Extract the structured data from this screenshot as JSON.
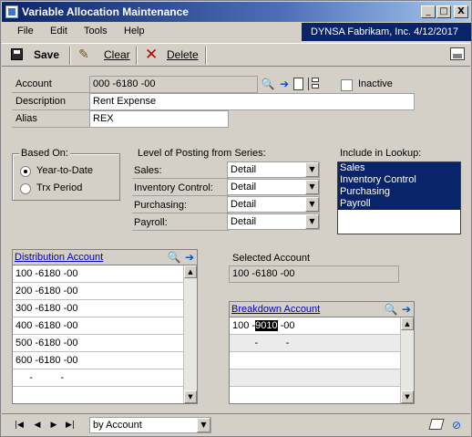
{
  "window": {
    "title": "Variable Allocation Maintenance",
    "minimize": "_",
    "maximize": "□",
    "close": "X"
  },
  "menu": {
    "items": [
      "File",
      "Edit",
      "Tools",
      "Help"
    ],
    "company": "DYNSA  Fabrikam, Inc.  4/12/2017"
  },
  "toolbar": {
    "save_label": "Save",
    "clear_label": "Clear",
    "delete_label": "Delete"
  },
  "form": {
    "account_label": "Account",
    "account_value": "000 -6180 -00",
    "description_label": "Description",
    "description_value": "Rent Expense",
    "alias_label": "Alias",
    "alias_value": "REX",
    "inactive_label": "Inactive"
  },
  "based_on": {
    "title": "Based On:",
    "options": [
      "Year-to-Date",
      "Trx Period"
    ],
    "selected": "Year-to-Date"
  },
  "posting_level": {
    "title": "Level of Posting from Series:",
    "rows": [
      {
        "label": "Sales:",
        "value": "Detail"
      },
      {
        "label": "Inventory Control:",
        "value": "Detail"
      },
      {
        "label": "Purchasing:",
        "value": "Detail"
      },
      {
        "label": "Payroll:",
        "value": "Detail"
      }
    ]
  },
  "lookup": {
    "title": "Include in Lookup:",
    "items": [
      "Sales",
      "Inventory Control",
      "Purchasing",
      "Payroll"
    ]
  },
  "distribution": {
    "header": "Distribution Account",
    "rows": [
      "100 -6180 -00",
      "200 -6180 -00",
      "300 -6180 -00",
      "400 -6180 -00",
      "500 -6180 -00",
      "600 -6180 -00",
      "     -          -"
    ]
  },
  "selected_account": {
    "label": "Selected Account",
    "value": "100 -6180 -00"
  },
  "breakdown": {
    "header": "Breakdown Account",
    "rows": [
      {
        "prefix": "100 -",
        "highlight": "9010",
        "suffix": " -00"
      },
      {
        "prefix": "        -          -",
        "highlight": "",
        "suffix": ""
      }
    ]
  },
  "footer": {
    "sort_value": "by Account"
  }
}
